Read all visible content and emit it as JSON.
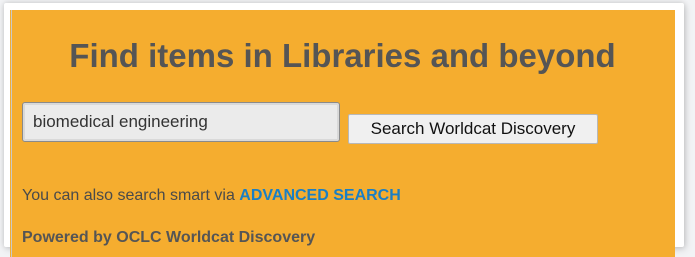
{
  "colors": {
    "panel_background": "#f5ad2f",
    "heading_text": "#555555",
    "link_text": "#1a7fc4",
    "input_background": "#ebebeb"
  },
  "heading": {
    "title": "Find items in Libraries and beyond"
  },
  "search": {
    "input_value": "biomedical engineering",
    "button_label": "Search Worldcat Discovery"
  },
  "advanced": {
    "prefix_text": "You can also search smart via ",
    "link_label": "ADVANCED SEARCH"
  },
  "footer": {
    "powered_by": "Powered by OCLC Worldcat Discovery"
  }
}
